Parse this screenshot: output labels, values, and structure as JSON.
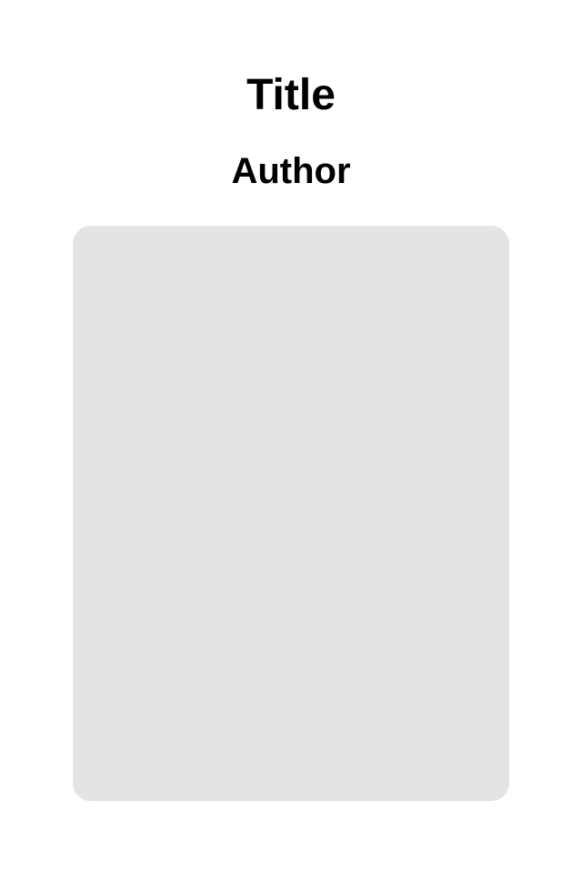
{
  "book": {
    "title": "Title",
    "author": "Author"
  },
  "colors": {
    "background": "#ffffff",
    "text": "#000000",
    "cover_placeholder": "#e4e4e4"
  }
}
